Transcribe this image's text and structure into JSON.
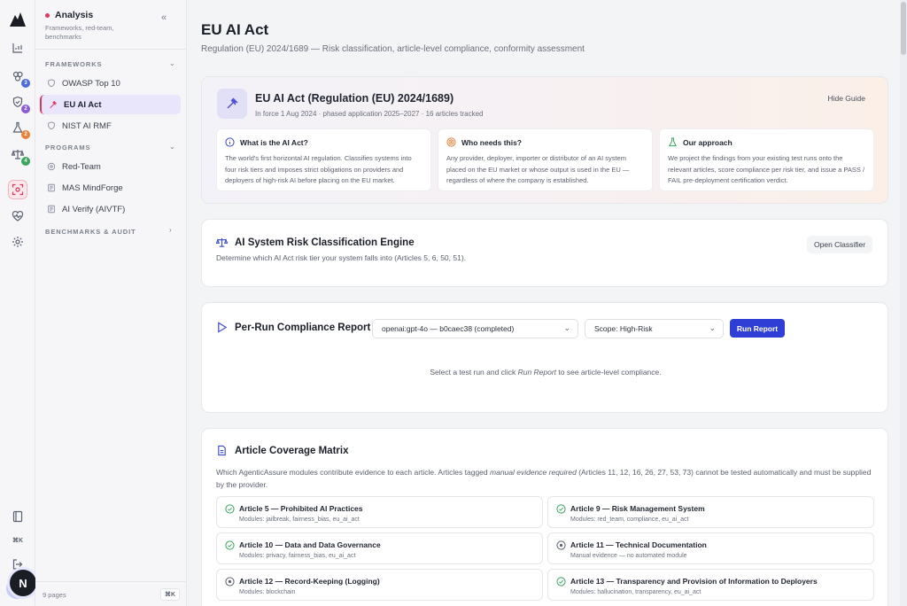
{
  "sidebar": {
    "title": "Analysis",
    "subtitle": "Frameworks, red-team, benchmarks",
    "collapse_label": "«",
    "sections": {
      "frameworks": "FRAMEWORKS",
      "programs": "PROGRAMS",
      "benchmarks": "BENCHMARKS & AUDIT"
    },
    "framework_items": [
      {
        "label": "OWASP Top 10",
        "icon": "shield-icon"
      },
      {
        "label": "EU AI Act",
        "icon": "gavel-icon",
        "active": true
      },
      {
        "label": "NIST AI RMF",
        "icon": "shield-icon"
      }
    ],
    "program_items": [
      {
        "label": "Red-Team",
        "icon": "target-icon"
      },
      {
        "label": "MAS MindForge",
        "icon": "document-icon"
      },
      {
        "label": "AI Verify (AIVTF)",
        "icon": "document-icon"
      }
    ],
    "footer": {
      "pages": "9 pages",
      "shortcut": "⌘K"
    }
  },
  "rail": {
    "badges": [
      "3",
      "2",
      "2",
      "4"
    ],
    "badge_colors": [
      "#4b6bdc",
      "#8a5bd6",
      "#e8823a",
      "#3aa55c"
    ],
    "avatar_initial": "N",
    "footer_shortcut": "⌘K"
  },
  "page": {
    "title": "EU AI Act",
    "subtitle": "Regulation (EU) 2024/1689 — Risk classification, article-level compliance, conformity assessment"
  },
  "guide": {
    "title": "EU AI Act (Regulation (EU) 2024/1689)",
    "subtitle": "In force 1 Aug 2024 · phased application 2025–2027 · 16 articles tracked",
    "hide_label": "Hide Guide",
    "boxes": [
      {
        "heading": "What is the AI Act?",
        "icon": "info-icon",
        "color": "#3b4ad1",
        "text": "The world's first horizontal AI regulation. Classifies systems into four risk tiers and imposes strict obligations on providers and deployers of high-risk AI before placing on the EU market."
      },
      {
        "heading": "Who needs this?",
        "icon": "target-icon",
        "color": "#e8823a",
        "text": "Any provider, deployer, importer or distributor of an AI system placed on the EU market or whose output is used in the EU — regardless of where the company is established."
      },
      {
        "heading": "Our approach",
        "icon": "flask-icon",
        "color": "#3aa55c",
        "text": "We project the findings from your existing test runs onto the relevant articles, score compliance per risk tier, and issue a PASS / FAIL pre-deployment certification verdict."
      }
    ]
  },
  "risk": {
    "title": "AI System Risk Classification Engine",
    "description": "Determine which AI Act risk tier your system falls into (Articles 5, 6, 50, 51).",
    "button": "Open Classifier"
  },
  "report": {
    "title": "Per-Run Compliance Report",
    "run_select": "openai:gpt-4o — b0caec38 (completed)",
    "scope_select": "Scope: High-Risk",
    "button": "Run Report",
    "empty_prefix": "Select a test run and click ",
    "empty_em": "Run Report",
    "empty_suffix": " to see article-level compliance."
  },
  "matrix": {
    "title": "Article Coverage Matrix",
    "desc_prefix": "Which AgenticAssure modules contribute evidence to each article. Articles tagged ",
    "desc_em": "manual evidence required",
    "desc_suffix": " (Articles 11, 12, 16, 26, 27, 53, 73) cannot be tested automatically and must be supplied by the provider.",
    "articles": [
      {
        "title": "Article 5 — Prohibited AI Practices",
        "modules": "Modules: jailbreak, fairness_bias, eu_ai_act",
        "status": "check-icon"
      },
      {
        "title": "Article 9 — Risk Management System",
        "modules": "Modules: red_team, compliance, eu_ai_act",
        "status": "check-icon"
      },
      {
        "title": "Article 10 — Data and Data Governance",
        "modules": "Modules: privacy, fairness_bias, eu_ai_act",
        "status": "check-icon"
      },
      {
        "title": "Article 11 — Technical Documentation",
        "modules": "Manual evidence — no automated module",
        "status": "dot-icon"
      },
      {
        "title": "Article 12 — Record-Keeping (Logging)",
        "modules": "Modules: blockchain",
        "status": "dot-icon"
      },
      {
        "title": "Article 13 — Transparency and Provision of Information to Deployers",
        "modules": "Modules: hallucination, transparency, eu_ai_act",
        "status": "check-icon"
      }
    ]
  }
}
